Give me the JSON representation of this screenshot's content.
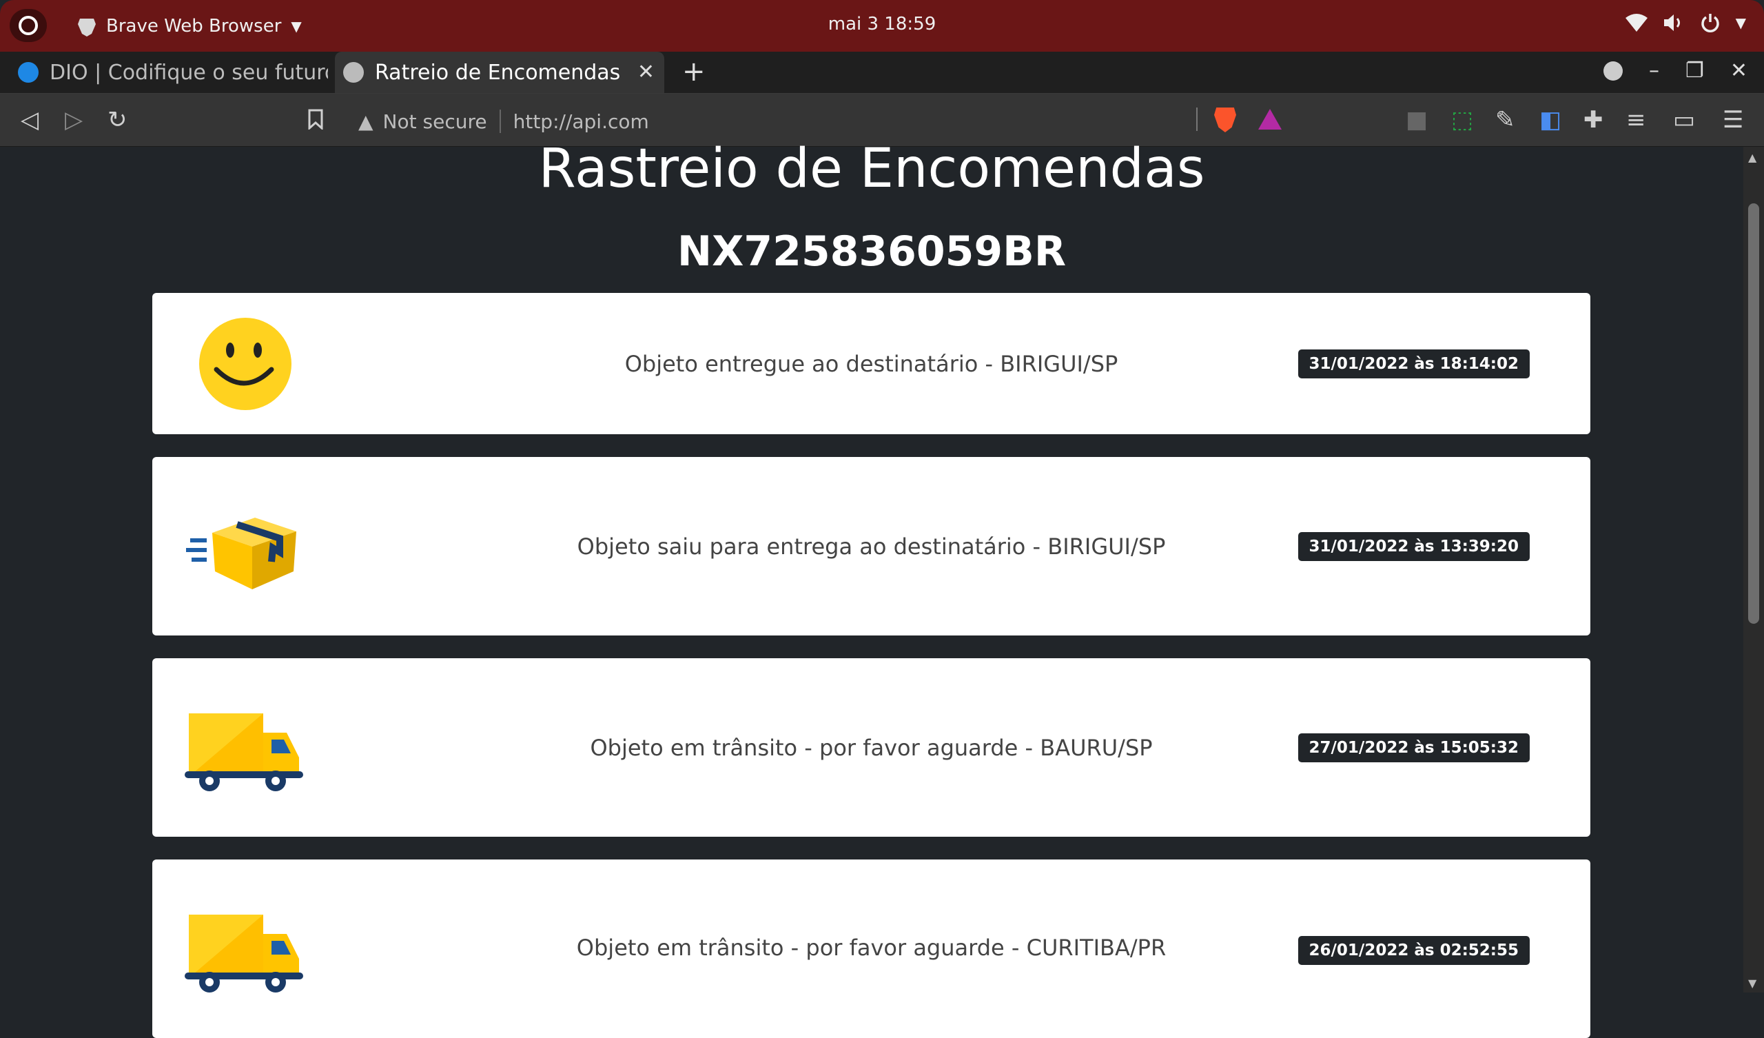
{
  "system_bar": {
    "app_name": "Brave Web Browser",
    "clock": "mai 3  18:59"
  },
  "tabs": [
    {
      "title": "DIO | Codifique o seu futuro global agora",
      "active": false
    },
    {
      "title": "Ratreio de Encomendas",
      "active": true
    }
  ],
  "toolbar": {
    "security_label": "Not secure",
    "url": "http://api.com"
  },
  "page": {
    "title": "Rastreio de Encomendas",
    "tracking_code": "NX725836059BR",
    "events": [
      {
        "icon": "smiley-icon",
        "status": "Objeto entregue ao destinatário - BIRIGUI/SP",
        "datetime": "31/01/2022 às 18:14:02"
      },
      {
        "icon": "package-icon",
        "status": "Objeto saiu para entrega ao destinatário - BIRIGUI/SP",
        "datetime": "31/01/2022 às 13:39:20"
      },
      {
        "icon": "truck-icon",
        "status": "Objeto em trânsito - por favor aguarde - BAURU/SP",
        "datetime": "27/01/2022 às 15:05:32"
      },
      {
        "icon": "truck-icon",
        "status": "Objeto em trânsito - por favor aguarde - CURITIBA/PR",
        "datetime": "26/01/2022 às 02:52:55"
      }
    ]
  },
  "colors": {
    "page_bg": "#212529",
    "system_bar": "#6a1616",
    "card_bg": "#ffffff",
    "badge_bg": "#212529",
    "icon_yellow": "#ffd21f"
  }
}
